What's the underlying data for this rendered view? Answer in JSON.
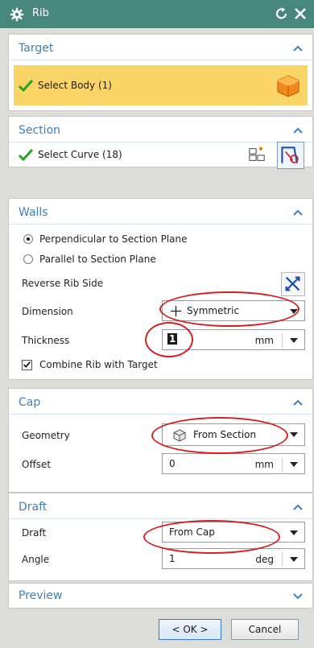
{
  "window": {
    "title": "Rib"
  },
  "target": {
    "title": "Target",
    "select_body": "Select Body (1)"
  },
  "section": {
    "title": "Section",
    "select_curve": "Select Curve (18)"
  },
  "walls": {
    "title": "Walls",
    "radio_perpendicular": "Perpendicular to Section Plane",
    "radio_parallel": "Parallel to Section Plane",
    "reverse_label": "Reverse Rib Side",
    "dimension_label": "Dimension",
    "dimension_value": "Symmetric",
    "thickness_label": "Thickness",
    "thickness_value": "1",
    "thickness_unit": "mm",
    "combine_label": "Combine Rib with Target"
  },
  "cap": {
    "title": "Cap",
    "geometry_label": "Geometry",
    "geometry_value": "From Section",
    "offset_label": "Offset",
    "offset_value": "0",
    "offset_unit": "mm"
  },
  "draft": {
    "title": "Draft",
    "draft_label": "Draft",
    "draft_value": "From Cap",
    "angle_label": "Angle",
    "angle_value": "1",
    "angle_unit": "deg"
  },
  "preview": {
    "title": "Preview"
  },
  "buttons": {
    "ok": "< OK >",
    "cancel": "Cancel"
  },
  "colors": {
    "titlebar": "#47877b",
    "section_title": "#3f7fb8",
    "highlight_row": "#fad467",
    "annotation_ring": "#d42020",
    "check": "#22a32a"
  },
  "icons": [
    "gear-icon",
    "reset-icon",
    "close-icon",
    "checkmark-icon",
    "solid-body-icon",
    "curve-rule-icon",
    "sketch-section-icon",
    "reverse-direction-icon",
    "symmetric-plus-icon",
    "from-section-cube-icon",
    "chevron-up-icon",
    "chevron-down-icon",
    "dropdown-arrow-icon"
  ]
}
